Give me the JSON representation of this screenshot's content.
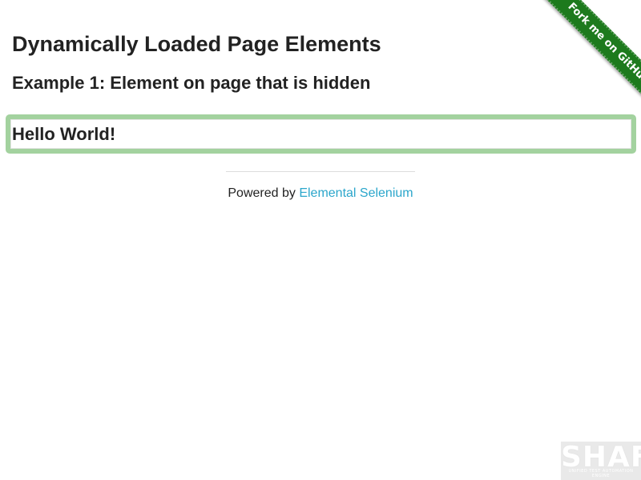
{
  "header": {
    "title": "Dynamically Loaded Page Elements",
    "subtitle": "Example 1: Element on page that is hidden"
  },
  "finish": {
    "text": "Hello World!"
  },
  "footer": {
    "powered_by": "Powered by ",
    "link_text": "Elemental Selenium"
  },
  "ribbon": {
    "text": "Fork me on GitHub"
  },
  "logo": {
    "name": "SHAFT",
    "tagline": "UNIFIED TEST AUTOMATION ENGINE"
  },
  "colors": {
    "ribbon": "#1d7a1d",
    "finish_border": "#a3d29f",
    "link": "#2ba6cb"
  }
}
